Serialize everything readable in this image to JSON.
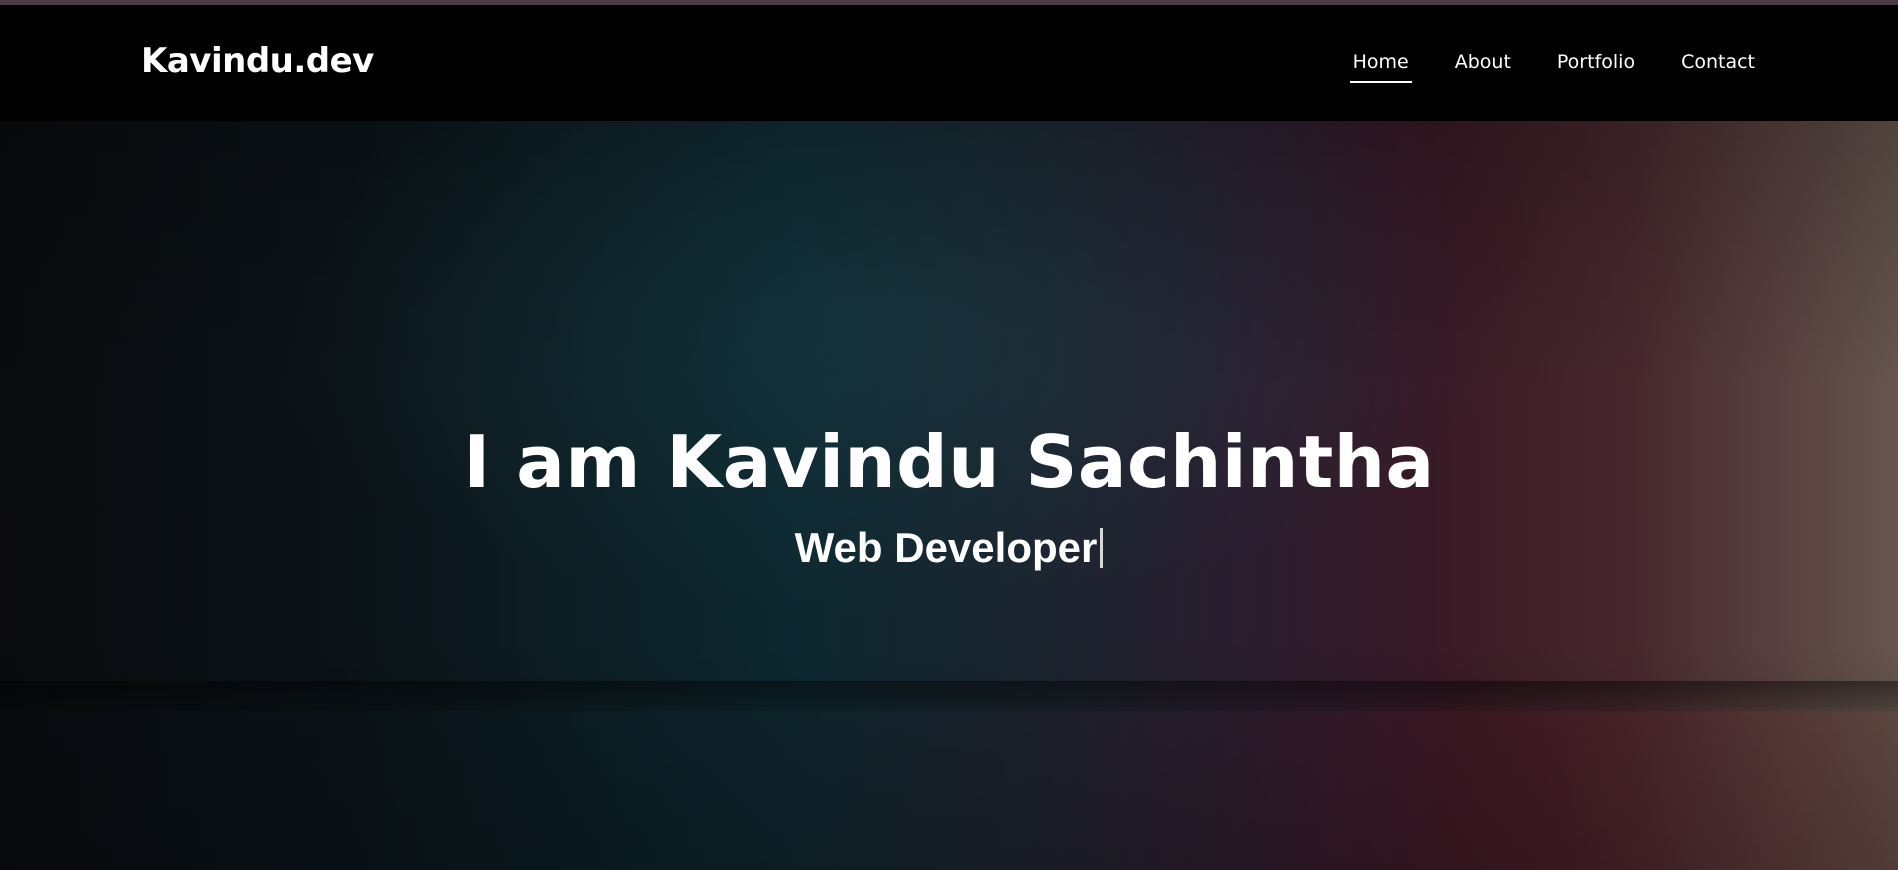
{
  "header": {
    "brand": "Kavindu.dev",
    "nav": [
      {
        "label": "Home",
        "active": true
      },
      {
        "label": "About",
        "active": false
      },
      {
        "label": "Portfolio",
        "active": false
      },
      {
        "label": "Contact",
        "active": false
      }
    ]
  },
  "hero": {
    "title": "I am Kavindu Sachintha",
    "subtitle": "Web Developer"
  },
  "colors": {
    "navbar_bg": "#000000",
    "text": "#ffffff"
  }
}
